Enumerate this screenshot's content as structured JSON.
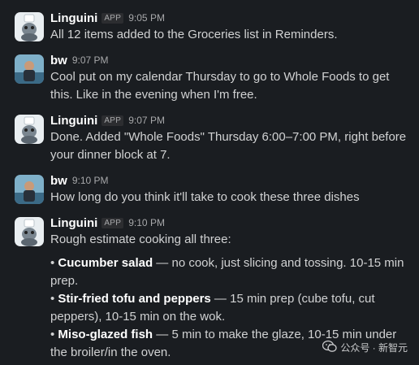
{
  "messages": [
    {
      "sender": "Linguini",
      "badge": "APP",
      "time": "9:05 PM",
      "text": "All 12 items added to the Groceries list in Reminders."
    },
    {
      "sender": "bw",
      "time": "9:07 PM",
      "text": "Cool put on my calendar Thursday to go to Whole Foods to get this. Like in the evening when I'm free."
    },
    {
      "sender": "Linguini",
      "badge": "APP",
      "time": "9:07 PM",
      "text": "Done. Added \"Whole Foods\" Thursday 6:00–7:00 PM, right before your dinner block at 7."
    },
    {
      "sender": "bw",
      "time": "9:10 PM",
      "text": "How long do you think it'll take to cook these three dishes"
    },
    {
      "sender": "Linguini",
      "badge": "APP",
      "time": "9:10 PM",
      "text": "Rough estimate cooking all three:",
      "bullets": [
        {
          "bold": "Cucumber salad",
          "rest": " — no cook, just slicing and tossing. 10-15 min prep."
        },
        {
          "bold": "Stir-fried tofu and peppers",
          "rest": " — 15 min prep (cube tofu, cut peppers), 10-15 min on the wok."
        },
        {
          "bold": "Miso-glazed fish",
          "rest": " — 5 min to make the glaze, 10-15 min under the broiler/in the oven."
        }
      ]
    }
  ],
  "watermark": {
    "text": "公众号 · 新智元",
    "icon": "wechat-icon"
  },
  "colors": {
    "background": "#1a1d21",
    "text": "#d1d2d3",
    "name": "#ffffff",
    "timestamp": "#a7a8aa"
  }
}
